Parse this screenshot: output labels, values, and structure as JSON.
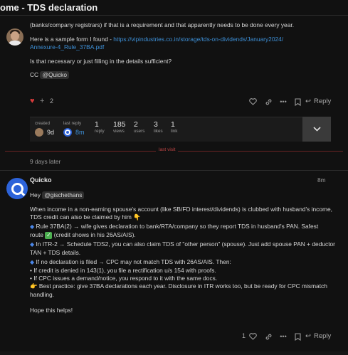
{
  "header": {
    "title": "ome - TDS declaration"
  },
  "post1": {
    "line_intro": "(banks/company registrars) if that is a requirement and that apparently needs to be done every year.",
    "sample_prefix": "Here is a sample form I found - ",
    "sample_link_line1": "https://vipindustries.co.in/storage/tds-on-dividends/January2024/",
    "sample_link_line2": "Annexure-4_Rule_37BA.pdf",
    "question": "Is that necessary or just filling in the details sufficient?",
    "cc_label": "CC",
    "cc_mention": "@Quicko",
    "like_count": "2",
    "reply_label": "Reply"
  },
  "stats": {
    "created_label": "created",
    "created_value": "9d",
    "last_reply_label": "last reply",
    "last_reply_value": "8m",
    "reply_num": "1",
    "reply_label": "reply",
    "views_num": "185",
    "views_label": "views",
    "users_num": "2",
    "users_label": "users",
    "likes_num": "3",
    "likes_label": "likes",
    "link_num": "1",
    "link_label": "link"
  },
  "timeline": {
    "last_visit": "last visit",
    "gap_text": "9 days later"
  },
  "post2": {
    "author": "Quicko",
    "time": "8m",
    "greeting": "Hey",
    "mention": "@gischethans",
    "p1_line1": "When income in a non-earning spouse's account (like SB/FD interest/dividends) is clubbed with husband's income,",
    "p1_line2": "TDS credit can also be claimed by him",
    "p1_emoji": "👇",
    "b1_line1": "Rule 37BA(2) → wife gives declaration to bank/RTA/company so they report TDS in husband's PAN. Safest",
    "b1_route": "route",
    "b1_route_rest": "(credit shows in his 26AS/AIS).",
    "b2_line1": "In ITR-2 → Schedule TDS2, you can also claim TDS of \"other person\" (spouse). Just add spouse PAN + deductor",
    "b2_line2": "TAN + TDS details.",
    "b3_line1": "If no declaration is filed → CPC may not match TDS with 26AS/AIS. Then:",
    "b3_sub1": "• If credit is denied in 143(1), you file a rectification u/s 154 with proofs.",
    "b3_sub2": "• If CPC issues a demand/notice, you respond to it with the same docs.",
    "tip_line1": "Best practice: give 37BA declarations each year. Disclosure in ITR works too, but be ready for CPC mismatch",
    "tip_line2": "handling.",
    "closing": "Hope this helps!",
    "like_count": "1",
    "reply_label": "Reply"
  },
  "colors": {
    "accent": "#3d8fd6",
    "heart": "#d83b3b",
    "last_visit": "#c24545",
    "quicko_blue": "#2d63d9"
  }
}
